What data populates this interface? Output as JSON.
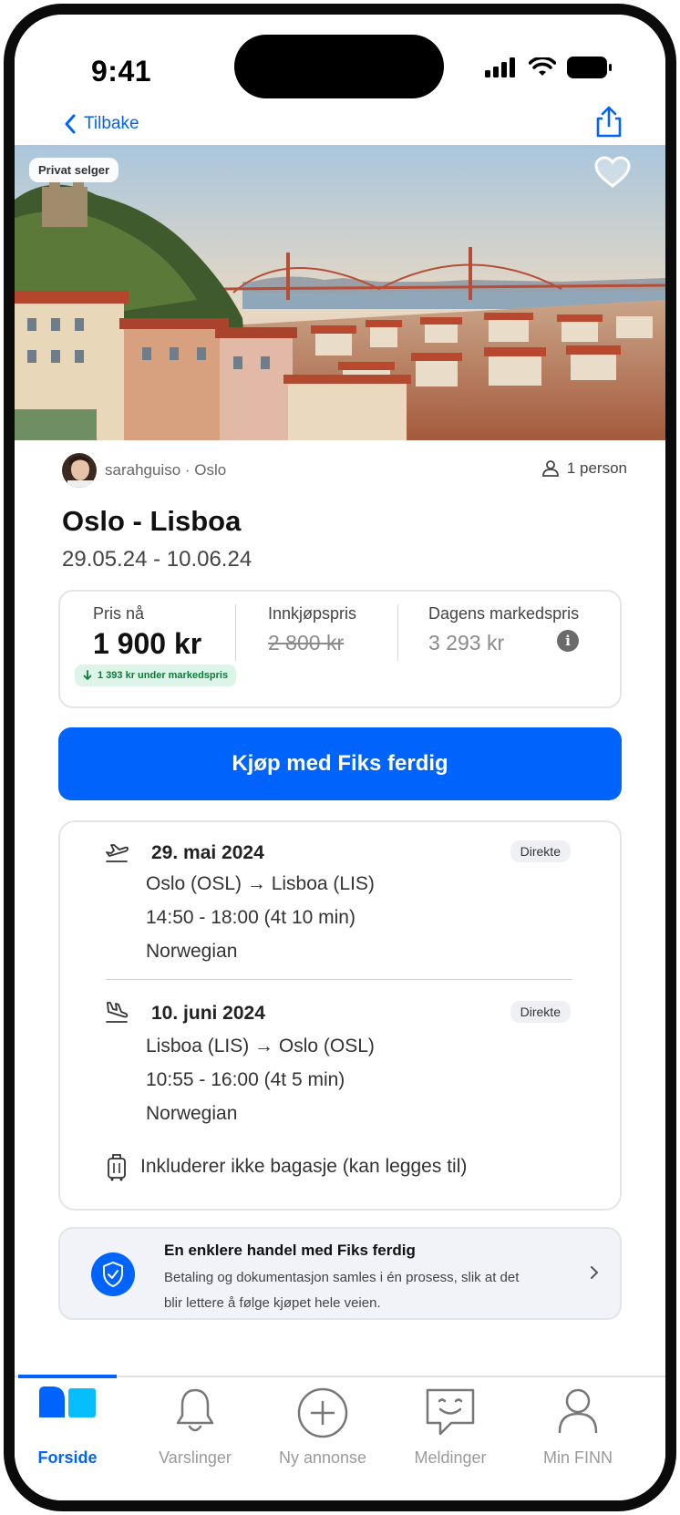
{
  "status_bar": {
    "time": "9:41"
  },
  "nav": {
    "back_label": "Tilbake"
  },
  "hero": {
    "badge": "Privat selger"
  },
  "seller": {
    "name_location": "sarahguiso · Oslo",
    "persons": "1 person"
  },
  "listing": {
    "title": "Oslo - Lisboa",
    "dates": "29.05.24 - 10.06.24"
  },
  "price": {
    "now_label": "Pris nå",
    "now_value": "1 900 kr",
    "purchase_label": "Innkjøpspris",
    "purchase_value": "2 800 kr",
    "market_label": "Dagens markedspris",
    "market_value": "3 293 kr",
    "under_badge": "1 393 kr under markedspris"
  },
  "buy_button": "Kjøp med Fiks ferdig",
  "outbound": {
    "date": "29. mai 2024",
    "badge": "Direkte",
    "route": "Oslo (OSL) → Lisboa (LIS)",
    "time": "14:50 - 18:00 (4t 10 min)",
    "airline": "Norwegian"
  },
  "inbound": {
    "date": "10. juni 2024",
    "badge": "Direkte",
    "route": "Lisboa (LIS) → Oslo (OSL)",
    "time": "10:55 - 16:00 (4t 5 min)",
    "airline": "Norwegian"
  },
  "baggage": "Inkluderer ikke bagasje (kan legges til)",
  "promo": {
    "title": "En enklere handel med Fiks ferdig",
    "text": "Betaling og dokumentasjon samles i én prosess, slik at det blir lettere å følge kjøpet hele veien."
  },
  "tabs": [
    {
      "label": "Forside",
      "icon": "home-icon",
      "active": true
    },
    {
      "label": "Varslinger",
      "icon": "bell-icon",
      "active": false
    },
    {
      "label": "Ny annonse",
      "icon": "plus-circle-icon",
      "active": false
    },
    {
      "label": "Meldinger",
      "icon": "chat-icon",
      "active": false
    },
    {
      "label": "Min FINN",
      "icon": "person-icon",
      "active": false
    }
  ],
  "colors": {
    "accent": "#0063fb",
    "badge_green_bg": "#ddf5e8",
    "badge_green_text": "#0d7a3c"
  }
}
